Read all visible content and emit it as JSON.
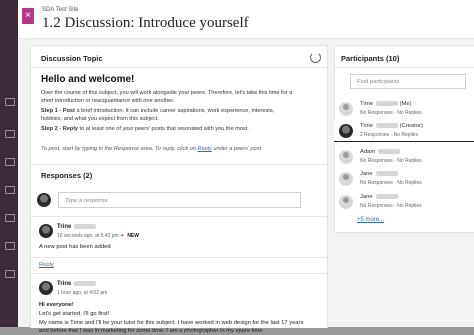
{
  "header": {
    "site_name": "SDA Test Site",
    "title": "1.2 Discussion: Introduce yourself",
    "close_label": "×"
  },
  "topic": {
    "heading": "Discussion Topic",
    "hello": "Hello and welcome!",
    "intro_1": "Over the course of this subject, you will work alongside your peers. Therefore, let's take this time for a",
    "intro_2": "short introduction or reacquaintance with one another.",
    "step1_label": "Step 1 - Post",
    "step1_text_1": " a brief introduction. It can include career aspirations, work experience, interests,",
    "step1_text_2": "hobbies, and what you expect from this subject.",
    "step2_label": "Step 2 - Reply",
    "step2_text": " to at least one of your peers' posts that resonated with you the most.",
    "instruction_pre": "To post, start by typing in the Response area. To reply, click on ",
    "instruction_link": "Reply",
    "instruction_post": " under a peers' post."
  },
  "responses": {
    "heading": "Responses (2)",
    "placeholder": "Type a response",
    "posts": [
      {
        "author": "Trine",
        "meta": "16 seconds ago, at 5:43 pm",
        "badge": "NEW",
        "body": "A new post has been added",
        "reply_label": "Reply"
      },
      {
        "author": "Trine",
        "meta": "1 hour ago, at 4:02 pm",
        "body_1": "Hi everyone!",
        "body_2": "Let's get started. I'll go first!",
        "body_3": "My name is Trine and I'll be your tutor for this subject. I have worked in web design for the last 17 years",
        "body_4": "and before that I was in marketing for some time. I am a photographer in my spare time"
      }
    ]
  },
  "participants": {
    "heading": "Participants (10)",
    "search_placeholder": "Find participants",
    "list": [
      {
        "name": "Trine",
        "role": "(Me)",
        "stats": "No Responses · No Replies"
      },
      {
        "name": "Trine",
        "role": "(Creator)",
        "stats": "2 Responses · No Replies"
      },
      {
        "name": "Adam",
        "role": "",
        "stats": "No Responses · No Replies"
      },
      {
        "name": "Jane",
        "role": "",
        "stats": "No Responses · No Replies"
      },
      {
        "name": "Jane",
        "role": "",
        "stats": "No Responses · No Replies"
      }
    ],
    "more_label": "+5 more..."
  }
}
